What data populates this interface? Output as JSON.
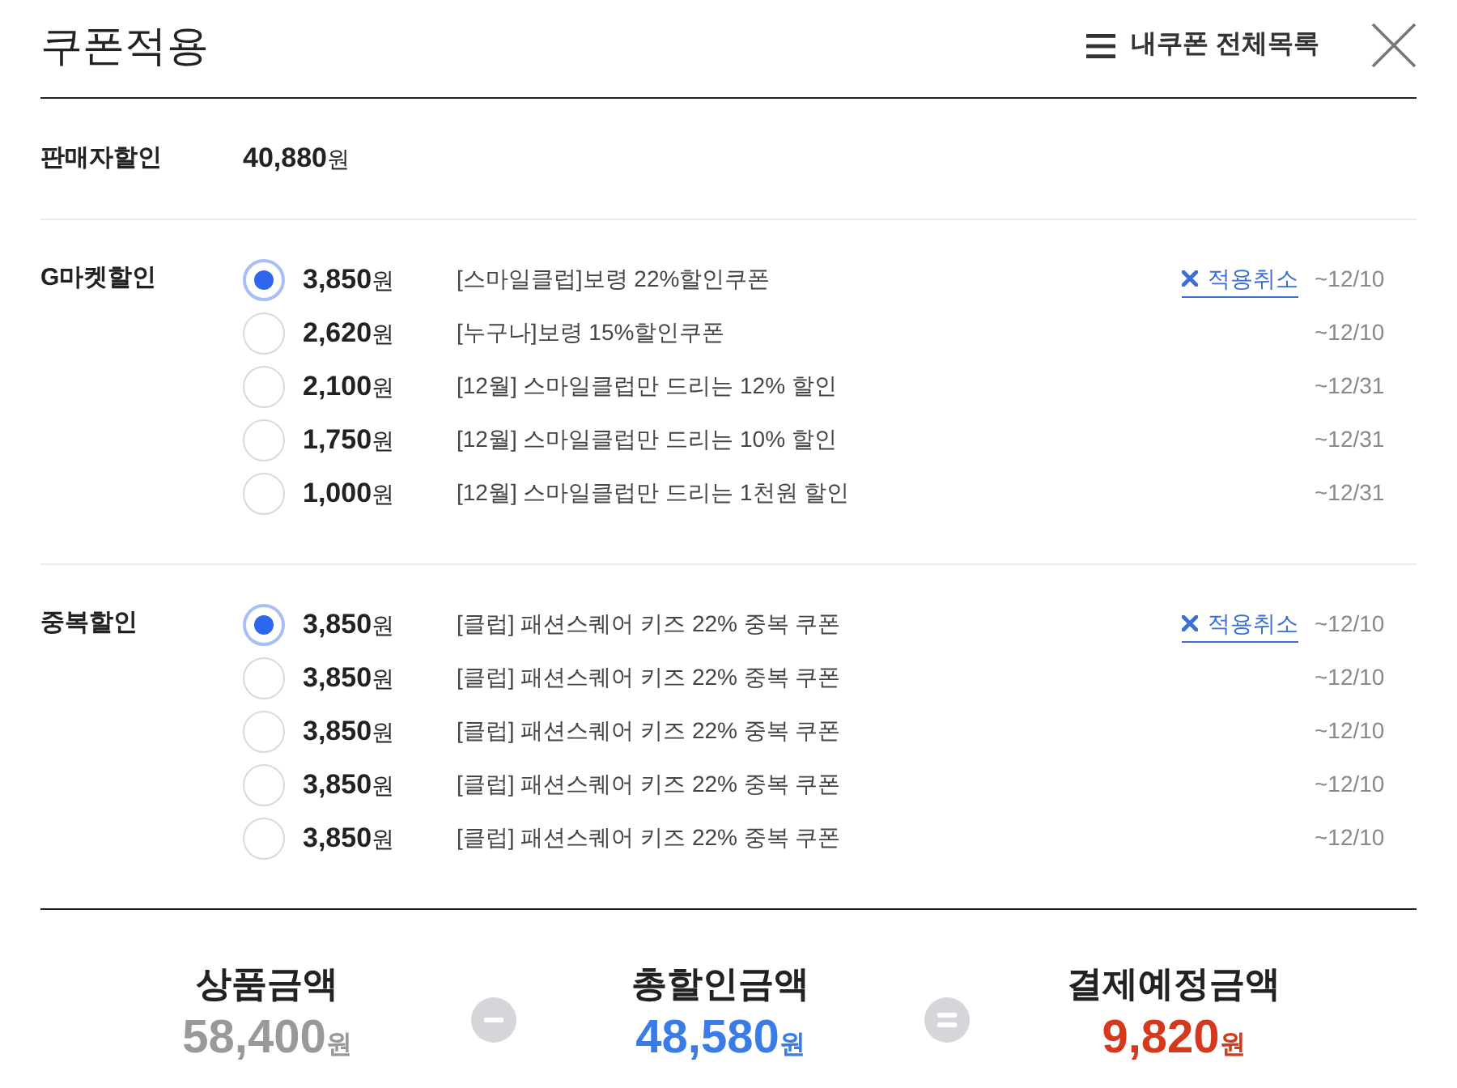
{
  "title": "쿠폰적용",
  "coupon_list_link": "내쿠폰 전체목록",
  "seller_discount": {
    "label": "판매자할인",
    "amount": "40,880",
    "unit": "원"
  },
  "sections": [
    {
      "label": "G마켓할인",
      "coupons": [
        {
          "amount": "3,850",
          "unit": "원",
          "name": "[스마일클럽]보령 22%할인쿠폰",
          "selected": true,
          "cancel": "적용취소",
          "expiry": "~12/10"
        },
        {
          "amount": "2,620",
          "unit": "원",
          "name": "[누구나]보령 15%할인쿠폰",
          "selected": false,
          "expiry": "~12/10"
        },
        {
          "amount": "2,100",
          "unit": "원",
          "name": "[12월] 스마일클럽만 드리는 12% 할인",
          "selected": false,
          "expiry": "~12/31"
        },
        {
          "amount": "1,750",
          "unit": "원",
          "name": "[12월] 스마일클럽만 드리는 10% 할인",
          "selected": false,
          "expiry": "~12/31"
        },
        {
          "amount": "1,000",
          "unit": "원",
          "name": "[12월] 스마일클럽만 드리는 1천원 할인",
          "selected": false,
          "expiry": "~12/31"
        }
      ]
    },
    {
      "label": "중복할인",
      "coupons": [
        {
          "amount": "3,850",
          "unit": "원",
          "name": "[클럽] 패션스퀘어 키즈 22% 중복 쿠폰",
          "selected": true,
          "cancel": "적용취소",
          "expiry": "~12/10"
        },
        {
          "amount": "3,850",
          "unit": "원",
          "name": "[클럽] 패션스퀘어 키즈 22% 중복 쿠폰",
          "selected": false,
          "expiry": "~12/10"
        },
        {
          "amount": "3,850",
          "unit": "원",
          "name": "[클럽] 패션스퀘어 키즈 22% 중복 쿠폰",
          "selected": false,
          "expiry": "~12/10"
        },
        {
          "amount": "3,850",
          "unit": "원",
          "name": "[클럽] 패션스퀘어 키즈 22% 중복 쿠폰",
          "selected": false,
          "expiry": "~12/10"
        },
        {
          "amount": "3,850",
          "unit": "원",
          "name": "[클럽] 패션스퀘어 키즈 22% 중복 쿠폰",
          "selected": false,
          "expiry": "~12/10"
        }
      ]
    }
  ],
  "summary": [
    {
      "kind": "amount",
      "label": "상품금액",
      "amount": "58,400",
      "unit": "원",
      "color": "#999999"
    },
    {
      "kind": "minus"
    },
    {
      "kind": "amount",
      "label": "총할인금액",
      "amount": "48,580",
      "unit": "원",
      "color": "#3a7be6"
    },
    {
      "kind": "equals"
    },
    {
      "kind": "amount",
      "label": "결제예정금액",
      "amount": "9,820",
      "unit": "원",
      "color": "#d4391d"
    }
  ]
}
